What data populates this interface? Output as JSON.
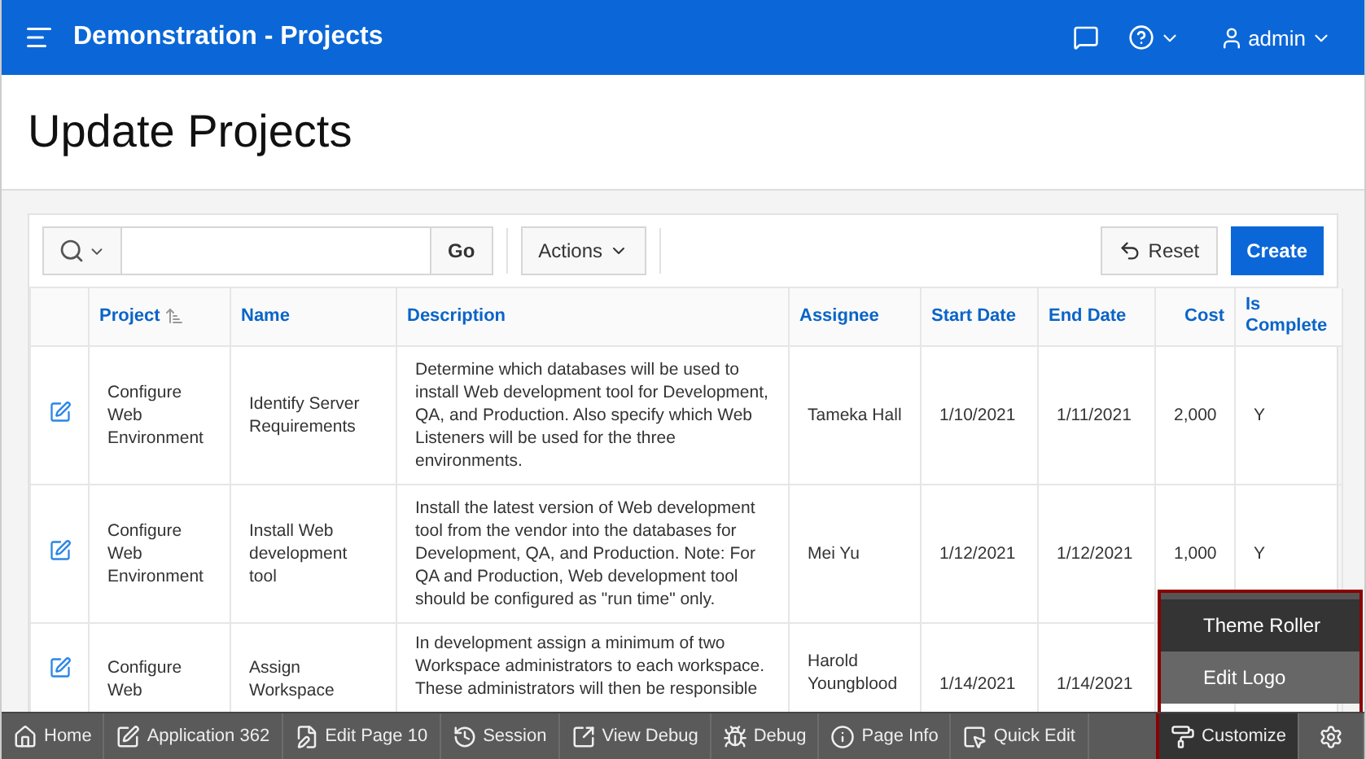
{
  "header": {
    "title": "Demonstration - Projects",
    "user": "admin"
  },
  "page_title": "Update Projects",
  "toolbar": {
    "go": "Go",
    "actions": "Actions",
    "reset": "Reset",
    "create": "Create"
  },
  "table": {
    "columns": [
      {
        "label": "Project",
        "sorted": true
      },
      {
        "label": "Name",
        "sorted": false
      },
      {
        "label": "Description",
        "sorted": false
      },
      {
        "label": "Assignee",
        "sorted": false
      },
      {
        "label": "Start Date",
        "sorted": false
      },
      {
        "label": "End Date",
        "sorted": false
      },
      {
        "label": "Cost",
        "sorted": false
      },
      {
        "label": "Is Complete",
        "sorted": false
      }
    ],
    "rows": [
      {
        "project": "Configure Web Environment",
        "name": "Identify Server Requirements",
        "description": "Determine which databases will be used to install Web development tool for Development, QA, and Production. Also specify which Web Listeners will be used for the three environments.",
        "assignee": "Tameka Hall",
        "start_date": "1/10/2021",
        "end_date": "1/11/2021",
        "cost": "2,000",
        "is_complete": "Y"
      },
      {
        "project": "Configure Web Environment",
        "name": "Install Web development tool",
        "description": "Install the latest version of Web development tool from the vendor into the databases for Development, QA, and Production. Note: For QA and Production, Web development tool should be configured as \"run time\" only.",
        "assignee": "Mei Yu",
        "start_date": "1/12/2021",
        "end_date": "1/12/2021",
        "cost": "1,000",
        "is_complete": "Y"
      },
      {
        "project": "Configure Web",
        "name": "Assign Workspace",
        "description": "In development assign a minimum of two Workspace administrators to each workspace. These administrators will then be responsible",
        "assignee": "Harold Youngblood",
        "start_date": "1/14/2021",
        "end_date": "1/14/2021"
      }
    ]
  },
  "dev_toolbar": [
    {
      "kind": "home",
      "label": "Home",
      "selected": false
    },
    {
      "kind": "application",
      "label": "Application 362",
      "selected": false
    },
    {
      "kind": "edit-page",
      "label": "Edit Page 10",
      "selected": false
    },
    {
      "kind": "session",
      "label": "Session",
      "selected": false
    },
    {
      "kind": "view-debug",
      "label": "View Debug",
      "selected": false
    },
    {
      "kind": "debug",
      "label": "Debug",
      "selected": false
    },
    {
      "kind": "page-info",
      "label": "Page Info",
      "selected": false
    },
    {
      "kind": "quick-edit",
      "label": "Quick Edit",
      "selected": false
    },
    {
      "kind": "customize",
      "label": "Customize",
      "selected": true
    },
    {
      "kind": "settings",
      "selected": false
    }
  ],
  "customize_menu": [
    {
      "label": "Theme Roller",
      "selected": true
    },
    {
      "label": "Edit Logo",
      "selected": false
    }
  ]
}
